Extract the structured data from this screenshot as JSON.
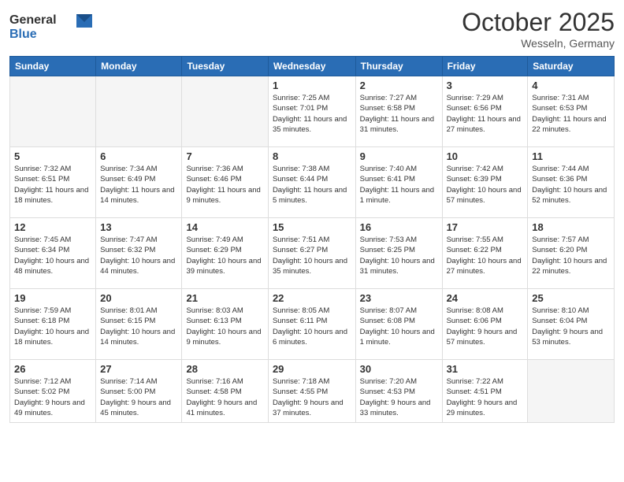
{
  "logo": {
    "general": "General",
    "blue": "Blue"
  },
  "title": "October 2025",
  "location": "Wesseln, Germany",
  "days_of_week": [
    "Sunday",
    "Monday",
    "Tuesday",
    "Wednesday",
    "Thursday",
    "Friday",
    "Saturday"
  ],
  "weeks": [
    [
      {
        "day": "",
        "info": ""
      },
      {
        "day": "",
        "info": ""
      },
      {
        "day": "",
        "info": ""
      },
      {
        "day": "1",
        "info": "Sunrise: 7:25 AM\nSunset: 7:01 PM\nDaylight: 11 hours and 35 minutes."
      },
      {
        "day": "2",
        "info": "Sunrise: 7:27 AM\nSunset: 6:58 PM\nDaylight: 11 hours and 31 minutes."
      },
      {
        "day": "3",
        "info": "Sunrise: 7:29 AM\nSunset: 6:56 PM\nDaylight: 11 hours and 27 minutes."
      },
      {
        "day": "4",
        "info": "Sunrise: 7:31 AM\nSunset: 6:53 PM\nDaylight: 11 hours and 22 minutes."
      }
    ],
    [
      {
        "day": "5",
        "info": "Sunrise: 7:32 AM\nSunset: 6:51 PM\nDaylight: 11 hours and 18 minutes."
      },
      {
        "day": "6",
        "info": "Sunrise: 7:34 AM\nSunset: 6:49 PM\nDaylight: 11 hours and 14 minutes."
      },
      {
        "day": "7",
        "info": "Sunrise: 7:36 AM\nSunset: 6:46 PM\nDaylight: 11 hours and 9 minutes."
      },
      {
        "day": "8",
        "info": "Sunrise: 7:38 AM\nSunset: 6:44 PM\nDaylight: 11 hours and 5 minutes."
      },
      {
        "day": "9",
        "info": "Sunrise: 7:40 AM\nSunset: 6:41 PM\nDaylight: 11 hours and 1 minute."
      },
      {
        "day": "10",
        "info": "Sunrise: 7:42 AM\nSunset: 6:39 PM\nDaylight: 10 hours and 57 minutes."
      },
      {
        "day": "11",
        "info": "Sunrise: 7:44 AM\nSunset: 6:36 PM\nDaylight: 10 hours and 52 minutes."
      }
    ],
    [
      {
        "day": "12",
        "info": "Sunrise: 7:45 AM\nSunset: 6:34 PM\nDaylight: 10 hours and 48 minutes."
      },
      {
        "day": "13",
        "info": "Sunrise: 7:47 AM\nSunset: 6:32 PM\nDaylight: 10 hours and 44 minutes."
      },
      {
        "day": "14",
        "info": "Sunrise: 7:49 AM\nSunset: 6:29 PM\nDaylight: 10 hours and 39 minutes."
      },
      {
        "day": "15",
        "info": "Sunrise: 7:51 AM\nSunset: 6:27 PM\nDaylight: 10 hours and 35 minutes."
      },
      {
        "day": "16",
        "info": "Sunrise: 7:53 AM\nSunset: 6:25 PM\nDaylight: 10 hours and 31 minutes."
      },
      {
        "day": "17",
        "info": "Sunrise: 7:55 AM\nSunset: 6:22 PM\nDaylight: 10 hours and 27 minutes."
      },
      {
        "day": "18",
        "info": "Sunrise: 7:57 AM\nSunset: 6:20 PM\nDaylight: 10 hours and 22 minutes."
      }
    ],
    [
      {
        "day": "19",
        "info": "Sunrise: 7:59 AM\nSunset: 6:18 PM\nDaylight: 10 hours and 18 minutes."
      },
      {
        "day": "20",
        "info": "Sunrise: 8:01 AM\nSunset: 6:15 PM\nDaylight: 10 hours and 14 minutes."
      },
      {
        "day": "21",
        "info": "Sunrise: 8:03 AM\nSunset: 6:13 PM\nDaylight: 10 hours and 9 minutes."
      },
      {
        "day": "22",
        "info": "Sunrise: 8:05 AM\nSunset: 6:11 PM\nDaylight: 10 hours and 6 minutes."
      },
      {
        "day": "23",
        "info": "Sunrise: 8:07 AM\nSunset: 6:08 PM\nDaylight: 10 hours and 1 minute."
      },
      {
        "day": "24",
        "info": "Sunrise: 8:08 AM\nSunset: 6:06 PM\nDaylight: 9 hours and 57 minutes."
      },
      {
        "day": "25",
        "info": "Sunrise: 8:10 AM\nSunset: 6:04 PM\nDaylight: 9 hours and 53 minutes."
      }
    ],
    [
      {
        "day": "26",
        "info": "Sunrise: 7:12 AM\nSunset: 5:02 PM\nDaylight: 9 hours and 49 minutes."
      },
      {
        "day": "27",
        "info": "Sunrise: 7:14 AM\nSunset: 5:00 PM\nDaylight: 9 hours and 45 minutes."
      },
      {
        "day": "28",
        "info": "Sunrise: 7:16 AM\nSunset: 4:58 PM\nDaylight: 9 hours and 41 minutes."
      },
      {
        "day": "29",
        "info": "Sunrise: 7:18 AM\nSunset: 4:55 PM\nDaylight: 9 hours and 37 minutes."
      },
      {
        "day": "30",
        "info": "Sunrise: 7:20 AM\nSunset: 4:53 PM\nDaylight: 9 hours and 33 minutes."
      },
      {
        "day": "31",
        "info": "Sunrise: 7:22 AM\nSunset: 4:51 PM\nDaylight: 9 hours and 29 minutes."
      },
      {
        "day": "",
        "info": ""
      }
    ]
  ]
}
